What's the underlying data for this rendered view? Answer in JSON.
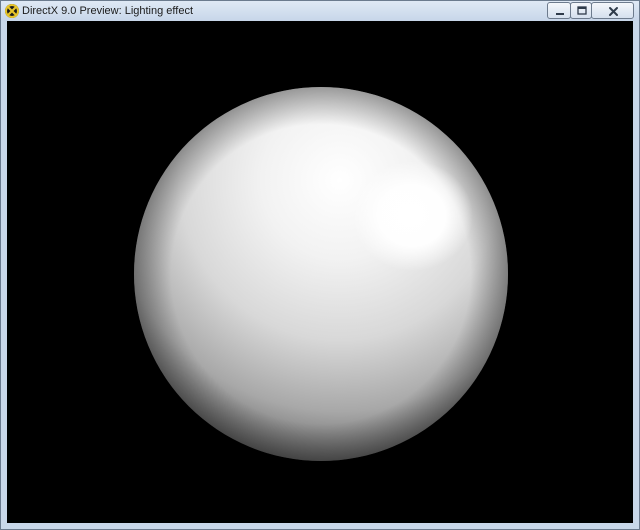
{
  "window": {
    "title": "DirectX 9.0 Preview: Lighting effect",
    "icon": "directx-icon"
  },
  "caption_buttons": {
    "minimize_icon": "minimize-icon",
    "maximize_icon": "restore-icon",
    "close_icon": "close-icon"
  },
  "viewport": {
    "background_color": "#000000",
    "object": "sphere-icon",
    "object_color": "#ffffff",
    "light_color": "#ffffff"
  }
}
